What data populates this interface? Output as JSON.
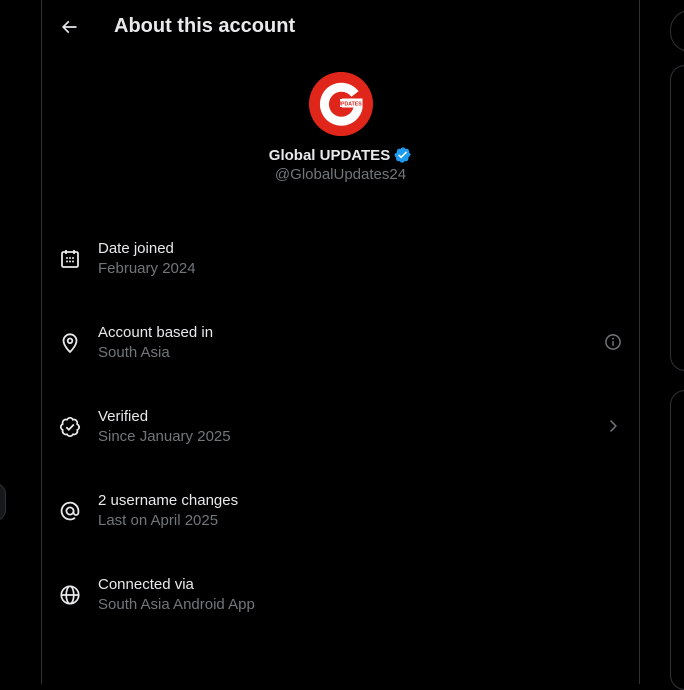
{
  "header": {
    "title": "About this account"
  },
  "profile": {
    "avatar_text": "UPDATES",
    "name": "Global UPDATES",
    "handle": "@GlobalUpdates24"
  },
  "rows": [
    {
      "title": "Date joined",
      "subtitle": "February 2024",
      "icon": "calendar-icon"
    },
    {
      "title": "Account based in",
      "subtitle": "South Asia",
      "icon": "location-pin-icon",
      "trailing": "info-icon"
    },
    {
      "title": "Verified",
      "subtitle": "Since January 2025",
      "icon": "verified-badge-icon",
      "trailing": "chevron-right-icon"
    },
    {
      "title": "2 username changes",
      "subtitle": "Last on April 2025",
      "icon": "at-sign-icon"
    },
    {
      "title": "Connected via",
      "subtitle": "South Asia Android App",
      "icon": "globe-icon"
    }
  ],
  "colors": {
    "background": "#000000",
    "text_primary": "#e7e9ea",
    "text_secondary": "#71767b",
    "border": "#2f3336",
    "verified_blue": "#1d9bf0",
    "avatar_red": "#e0261b"
  }
}
